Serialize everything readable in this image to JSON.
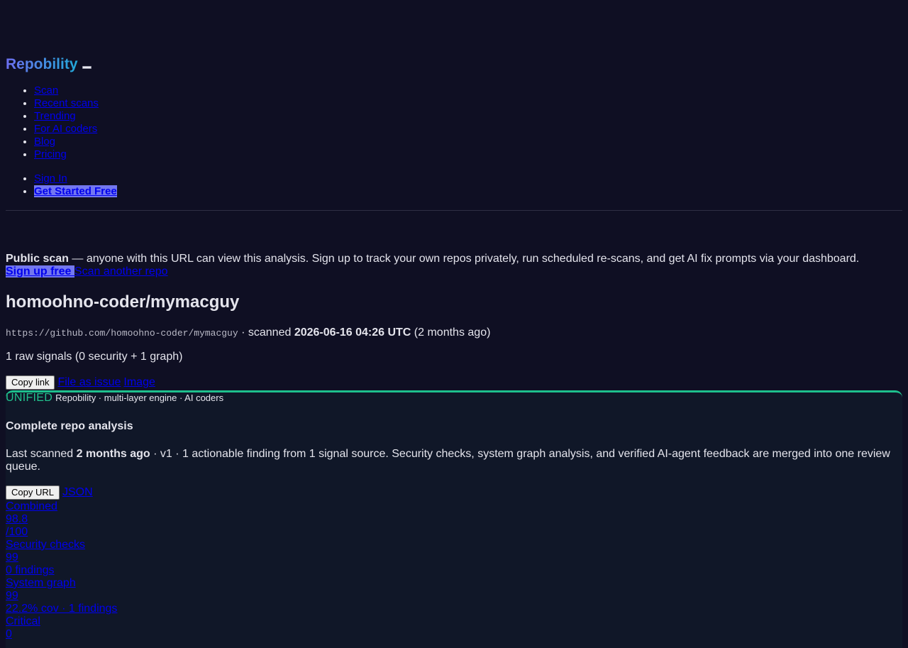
{
  "header": {
    "brand": "Repobility",
    "nav": [
      "Scan",
      "Recent scans",
      "Trending",
      "For AI coders",
      "Blog",
      "Pricing"
    ],
    "auth": {
      "sign_in": "Sign In",
      "get_started": "Get Started Free"
    }
  },
  "notice": {
    "strong": "Public scan",
    "text": " — anyone with this URL can view this analysis. Sign up to track your own repos privately, run scheduled re-scans, and get AI fix prompts via your dashboard.",
    "signup": "Sign up free ",
    "scan_another": "Scan another repo"
  },
  "repo": {
    "title": "homoohno-coder/mymacguy",
    "url": "https://github.com/homoohno-coder/mymacguy",
    "scanned_prefix": " · scanned ",
    "scanned_at": "2026-06-16 04:26 UTC",
    "scanned_ago": " (2 months ago)",
    "signals": "1 raw signals (0 security + 1 graph)"
  },
  "actions": {
    "copy_link": "Copy link",
    "file_issue": "File as issue",
    "image": "Image"
  },
  "card": {
    "badge": "UNIFIED",
    "engine": "Repobility · multi-layer engine · AI coders",
    "title": "Complete repo analysis",
    "desc_prefix": "Last scanned ",
    "desc_strong": "2 months ago",
    "desc_rest": " · v1 · 1 actionable finding from 1 signal source. Security checks, system graph analysis, and verified AI-agent feedback are merged into one review queue.",
    "copy_url": "Copy URL",
    "json": "JSON"
  },
  "metrics": [
    {
      "label": "Combined",
      "value": "98.8",
      "sub": "/100"
    },
    {
      "label": "Security checks",
      "value": "99",
      "sub": "0 findings"
    },
    {
      "label": "System graph",
      "value": "99",
      "sub": "22.2% cov · 1 findings"
    },
    {
      "label": "Critical",
      "value": "0",
      "sub": ""
    }
  ]
}
